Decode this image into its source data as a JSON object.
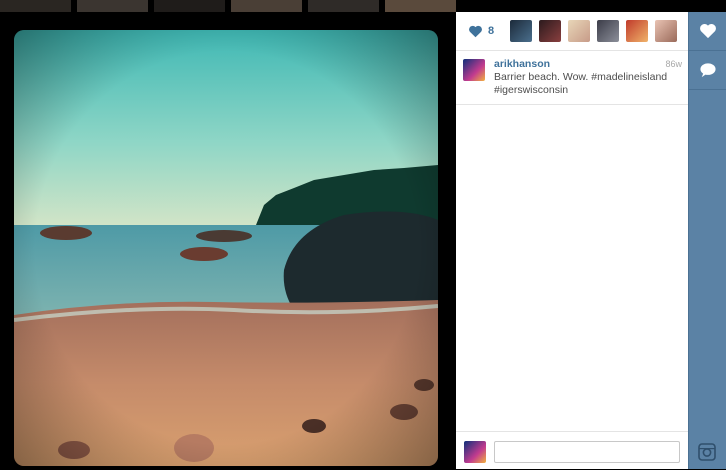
{
  "likes": {
    "count": "8"
  },
  "post": {
    "username": "arikhanson",
    "time": "86w",
    "caption": "Barrier beach. Wow. #madelineisland #igerswisconsin"
  },
  "comment": {
    "placeholder": ""
  },
  "colors": {
    "accent": "#3f729b",
    "rail": "#5b82a5"
  },
  "icons": {
    "like": "heart-icon",
    "comment": "speech-bubble-icon",
    "brand": "instagram-camera-icon"
  }
}
